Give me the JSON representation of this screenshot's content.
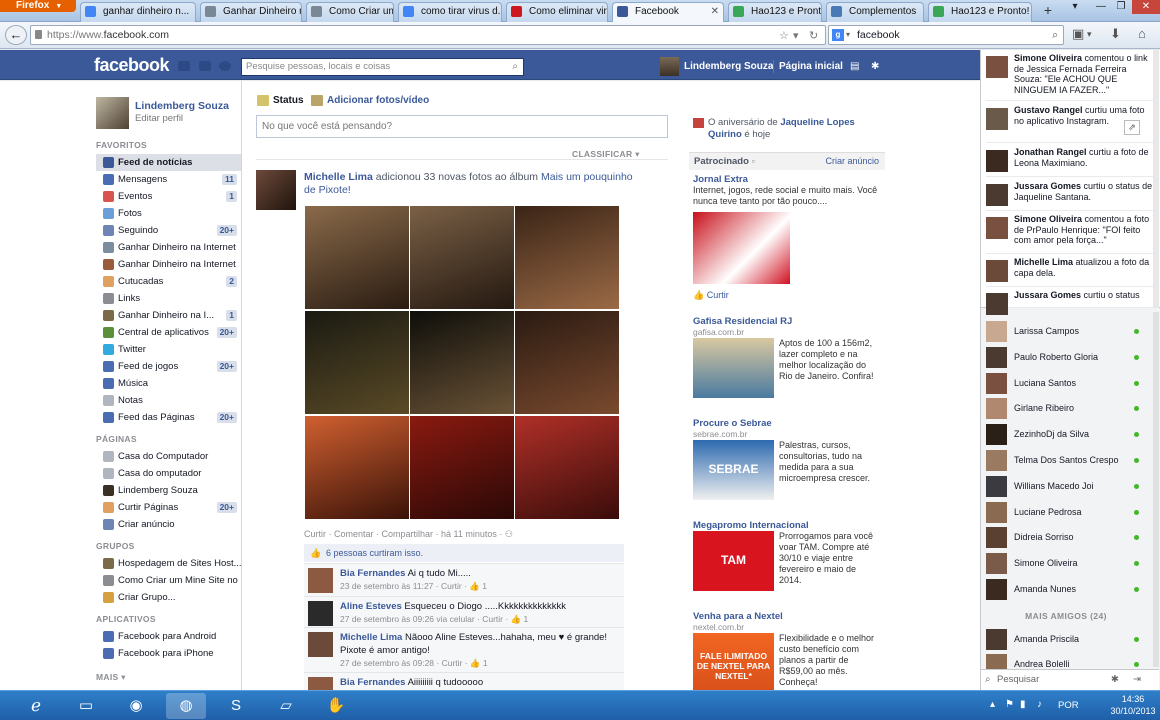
{
  "browser": {
    "menu_label": "Firefox",
    "tabs": [
      {
        "title": "ganhar dinheiro n...",
        "icon": "google-icon",
        "color": "#4285f4"
      },
      {
        "title": "Ganhar Dinheiro na...",
        "icon": "page-icon",
        "color": "#7a8896"
      },
      {
        "title": "Como Criar um M...",
        "icon": "page-icon",
        "color": "#7a8896"
      },
      {
        "title": "como tirar virus d...",
        "icon": "google-icon",
        "color": "#4285f4"
      },
      {
        "title": "Como eliminar vir...",
        "icon": "youtube-icon",
        "color": "#cc181e"
      },
      {
        "title": "Facebook",
        "icon": "facebook-icon",
        "color": "#3b5998"
      },
      {
        "title": "Hao123 e Pronto!",
        "icon": "page-icon",
        "color": "#3aa757"
      },
      {
        "title": "Complementos",
        "icon": "puzzle-icon",
        "color": "#4a7ab5"
      },
      {
        "title": "Hao123 e Pronto!",
        "icon": "page-icon",
        "color": "#3aa757"
      }
    ],
    "url_prefix": "https://www.",
    "url_host": "facebook.com",
    "search_value": "facebook"
  },
  "fb": {
    "logo": "facebook",
    "search_placeholder": "Pesquise pessoas, locais e coisas",
    "user_name": "Lindemberg Souza",
    "home_label": "Página inicial"
  },
  "left": {
    "profile_name": "Lindemberg Souza",
    "edit_profile": "Editar perfil",
    "favorites_title": "FAVORITOS",
    "favorites": [
      {
        "label": "Feed de notícias",
        "count": "",
        "color": "#3b5998"
      },
      {
        "label": "Mensagens",
        "count": "11",
        "color": "#4a6cb3"
      },
      {
        "label": "Eventos",
        "count": "1",
        "color": "#d9534f"
      },
      {
        "label": "Fotos",
        "count": "",
        "color": "#6a9fd8"
      },
      {
        "label": "Seguindo",
        "count": "20+",
        "color": "#6d84b4"
      },
      {
        "label": "Ganhar Dinheiro na Internet",
        "count": "",
        "color": "#7b8d9e"
      },
      {
        "label": "Ganhar Dinheiro na Internet",
        "count": "",
        "color": "#9a5b3c"
      },
      {
        "label": "Cutucadas",
        "count": "2",
        "color": "#e0a060"
      },
      {
        "label": "Links",
        "count": "",
        "color": "#8b8d92"
      },
      {
        "label": "Ganhar Dinheiro na I...",
        "count": "1",
        "color": "#7b6a4a"
      },
      {
        "label": "Central de aplicativos",
        "count": "20+",
        "color": "#5b8f3a"
      },
      {
        "label": "Twitter",
        "count": "",
        "color": "#33aadd"
      },
      {
        "label": "Feed de jogos",
        "count": "20+",
        "color": "#4a6cb3"
      },
      {
        "label": "Música",
        "count": "",
        "color": "#4a6cb3"
      },
      {
        "label": "Notas",
        "count": "",
        "color": "#b0b6c0"
      },
      {
        "label": "Feed das Páginas",
        "count": "20+",
        "color": "#4a6cb3"
      }
    ],
    "pages_title": "PÁGINAS",
    "pages": [
      {
        "label": "Casa do Computador",
        "count": "",
        "color": "#b0b6c0"
      },
      {
        "label": "Casa do omputador",
        "count": "",
        "color": "#b0b6c0"
      },
      {
        "label": "Lindemberg Souza",
        "count": "",
        "color": "#3b3024"
      },
      {
        "label": "Curtir Páginas",
        "count": "20+",
        "color": "#e0a060"
      },
      {
        "label": "Criar anúncio",
        "count": "",
        "color": "#6d84b4"
      }
    ],
    "groups_title": "GRUPOS",
    "groups": [
      {
        "label": "Hospedagem de Sites Host...",
        "count": "",
        "color": "#7b6a4a"
      },
      {
        "label": "Como Criar um Mine Site no ...",
        "count": "",
        "color": "#8b8d92"
      },
      {
        "label": "Criar Grupo...",
        "count": "",
        "color": "#d4a040"
      }
    ],
    "apps_title": "APLICATIVOS",
    "apps": [
      {
        "label": "Facebook para Android",
        "count": "",
        "color": "#4a6cb3"
      },
      {
        "label": "Facebook para iPhone",
        "count": "",
        "color": "#4a6cb3"
      }
    ],
    "more_label": "MAIS ▾"
  },
  "composer": {
    "status_tab": "Status",
    "photo_tab": "Adicionar fotos/vídeo",
    "placeholder": "No que você está pensando?",
    "sort_label": "CLASSIFICAR ▾"
  },
  "story": {
    "author": "Michelle Lima",
    "action": " adicionou 33 novas fotos ao álbum ",
    "album": "Mais um pouquinho de Pixote!",
    "actions_line": "Curtir · Comentar · Compartilhar · há 11 minutos · ",
    "likes_line": "6 pessoas curtiram isso.",
    "comments": [
      {
        "name": "Bia Fernandes",
        "text": " Ai q tudo Mi.....",
        "meta": "23 de setembro às 11:27 · Curtir · 👍 1"
      },
      {
        "name": "Aline Esteves",
        "text": " Esqueceu o Diogo .....Kkkkkkkkkkkkkk",
        "meta": "27 de setembro às 09:26 via celular · Curtir · 👍 1"
      },
      {
        "name": "Michelle Lima",
        "text": " Nãooo Aline Esteves...hahaha, meu ♥ é grande! Pixote é amor antigo!",
        "meta": "27 de setembro às 09:28 · Curtir · 👍 1"
      },
      {
        "name": "Bia Fernandes",
        "text": " Aiiiiiiiii q tudooooo",
        "meta": ""
      }
    ]
  },
  "rightcol": {
    "birthday_prefix": "O aniversário de ",
    "birthday_name": "Jaqueline Lopes Quirino",
    "birthday_suffix": " é hoje",
    "sponsored": "Patrocinado",
    "create_ad": "Criar anúncio",
    "ads": [
      {
        "title": "Jornal Extra",
        "url": "",
        "body": "Internet, jogos, rede social e muito mais. Você nunca teve tanto por tão pouco....",
        "like": "👍 Curtir"
      },
      {
        "title": "Gafisa Residencial RJ",
        "url": "gafisa.com.br",
        "body": "Aptos de 100 a 156m2, lazer completo e na melhor localização do Rio de Janeiro. Confira!",
        "like": ""
      },
      {
        "title": "Procure o Sebrae",
        "url": "sebrae.com.br",
        "body": "Palestras, cursos, consultorias, tudo na medida para a sua microempresa crescer.",
        "like": ""
      },
      {
        "title": "Megapromo Internacional",
        "url": "",
        "body": "Prorrogamos para você voar TAM. Compre até 30/10 e viaje entre fevereiro e maio de 2014.",
        "like": ""
      },
      {
        "title": "Venha para a Nextel",
        "url": "nextel.com.br",
        "body": "Flexibilidade e o melhor custo benefício com planos a partir de R$59,00 ao mês. Conheça!",
        "like": ""
      }
    ],
    "ad_image_texts": [
      "",
      "",
      "SEBRAE",
      "TAM",
      "FALE ILIMITADO DE NEXTEL PARA NEXTEL*"
    ]
  },
  "ticker": [
    {
      "name": "Simone Oliveira",
      "text": " comentou o link de Jessica Fernada Ferreira Souza: \"Ele ACHOU QUE NINGUEM IA FAZER...\""
    },
    {
      "name": "Gustavo Rangel",
      "text": " curtiu uma foto no aplicativo Instagram."
    },
    {
      "name": "Jonathan Rangel",
      "text": " curtiu a foto de Leona Maximiano."
    },
    {
      "name": "Jussara Gomes",
      "text": " curtiu o status de Jaqueline Santana."
    },
    {
      "name": "Simone Oliveira",
      "text": " comentou a foto de PrPaulo Henrique: \"FOI feito com amor pela força...\""
    },
    {
      "name": "Michelle Lima",
      "text": " atualizou a foto da capa dela."
    },
    {
      "name": "Jussara Gomes",
      "text": " curtiu o status"
    }
  ],
  "chat": {
    "online": [
      "Larissa Campos",
      "Paulo Roberto Gloria",
      "Luciana Santos",
      "Girlane Ribeiro",
      "ZezinhoDj da Silva",
      "Telma Dos Santos Crespo",
      "Willians Macedo Joi",
      "Luciane Pedrosa",
      "Didreia Sorriso",
      "Simone Oliveira",
      "Amanda Nunes"
    ],
    "more_friends": "MAIS AMIGOS (24)",
    "more": [
      "Amanda Priscila",
      "Andrea Bolelli"
    ],
    "search_placeholder": "Pesquisar"
  },
  "taskbar": {
    "lang": "POR",
    "time": "14:36",
    "date": "30/10/2013"
  }
}
